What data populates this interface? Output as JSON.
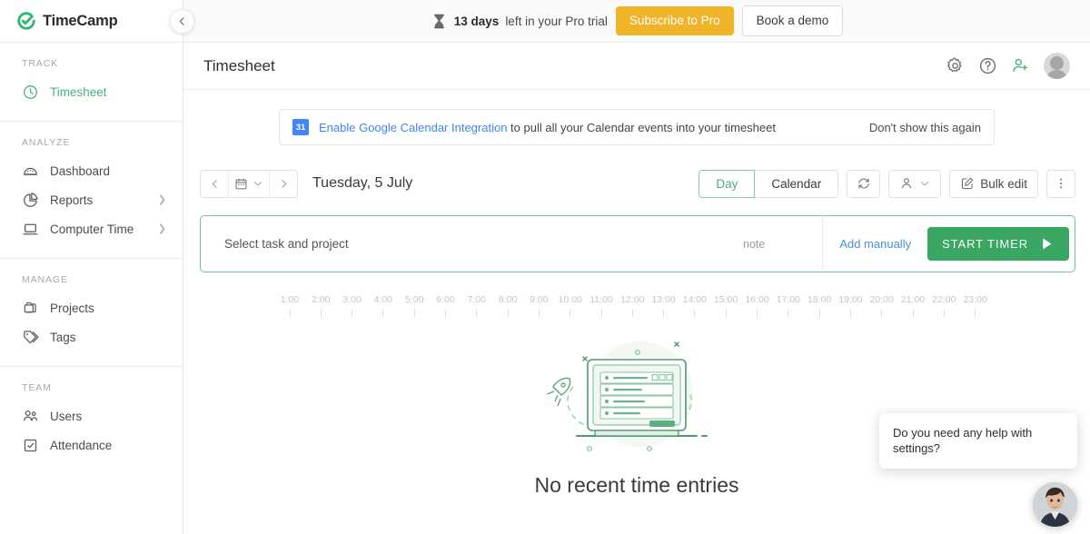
{
  "brand": {
    "name": "TimeCamp",
    "logo_icon": "circle-check-icon",
    "accent_green": "#4caf7d",
    "accent_yellow": "#f0b429",
    "link_blue": "#4285f4"
  },
  "sidebar": {
    "collapse_icon": "chevron-left-icon",
    "sections": [
      {
        "label": "TRACK",
        "items": [
          {
            "label": "Timesheet",
            "icon": "clock-icon",
            "active": true,
            "chevron": false
          }
        ]
      },
      {
        "label": "ANALYZE",
        "items": [
          {
            "label": "Dashboard",
            "icon": "gauge-icon",
            "active": false,
            "chevron": false
          },
          {
            "label": "Reports",
            "icon": "pie-chart-icon",
            "active": false,
            "chevron": true
          },
          {
            "label": "Computer Time",
            "icon": "laptop-icon",
            "active": false,
            "chevron": true
          }
        ]
      },
      {
        "label": "MANAGE",
        "items": [
          {
            "label": "Projects",
            "icon": "folder-icon",
            "active": false,
            "chevron": false
          },
          {
            "label": "Tags",
            "icon": "tag-icon",
            "active": false,
            "chevron": false
          }
        ]
      },
      {
        "label": "TEAM",
        "items": [
          {
            "label": "Users",
            "icon": "users-icon",
            "active": false,
            "chevron": false
          },
          {
            "label": "Attendance",
            "icon": "checkbox-icon",
            "active": false,
            "chevron": false
          }
        ]
      }
    ]
  },
  "trial_bar": {
    "icon": "hourglass-icon",
    "days": "13 days",
    "message": "left in your Pro trial",
    "subscribe_label": "Subscribe to Pro",
    "demo_label": "Book a demo"
  },
  "header": {
    "title": "Timesheet",
    "icons": [
      "gear-icon",
      "help-circle-icon",
      "add-user-icon",
      "avatar"
    ]
  },
  "gcal_banner": {
    "icon_label": "31",
    "link_text": "Enable Google Calendar Integration",
    "rest_text": " to pull all your Calendar events into your timesheet",
    "dismiss_label": "Don't show this again"
  },
  "toolbar": {
    "prev_icon": "chevron-left-icon",
    "calendar_icon": "calendar-icon",
    "calendar_chevron": "chevron-down-icon",
    "next_icon": "chevron-right-icon",
    "date_label": "Tuesday, 5 July",
    "view_day": "Day",
    "view_calendar": "Calendar",
    "refresh_icon": "refresh-icon",
    "person_icon": "person-icon",
    "person_chevron": "chevron-down-icon",
    "bulk_edit_label": "Bulk edit",
    "bulk_edit_icon": "pencil-square-icon",
    "kebab_icon": "more-vertical-icon"
  },
  "timer": {
    "task_placeholder": "Select task and project",
    "note_placeholder": "note",
    "add_manually_label": "Add manually",
    "start_label": "START TIMER",
    "play_icon": "play-icon"
  },
  "timeline": {
    "ticks": [
      "1:00",
      "2:00",
      "3:00",
      "4:00",
      "5:00",
      "6:00",
      "7:00",
      "8:00",
      "9:00",
      "10:00",
      "11:00",
      "12:00",
      "13:00",
      "14:00",
      "15:00",
      "16:00",
      "17:00",
      "18:00",
      "19:00",
      "20:00",
      "21:00",
      "22:00",
      "23:00"
    ]
  },
  "empty_state": {
    "illustration": "laptop-rocket-illustration",
    "title": "No recent time entries"
  },
  "chat_widget": {
    "message": "Do you need any help with settings?",
    "avatar": "support-agent-avatar"
  }
}
